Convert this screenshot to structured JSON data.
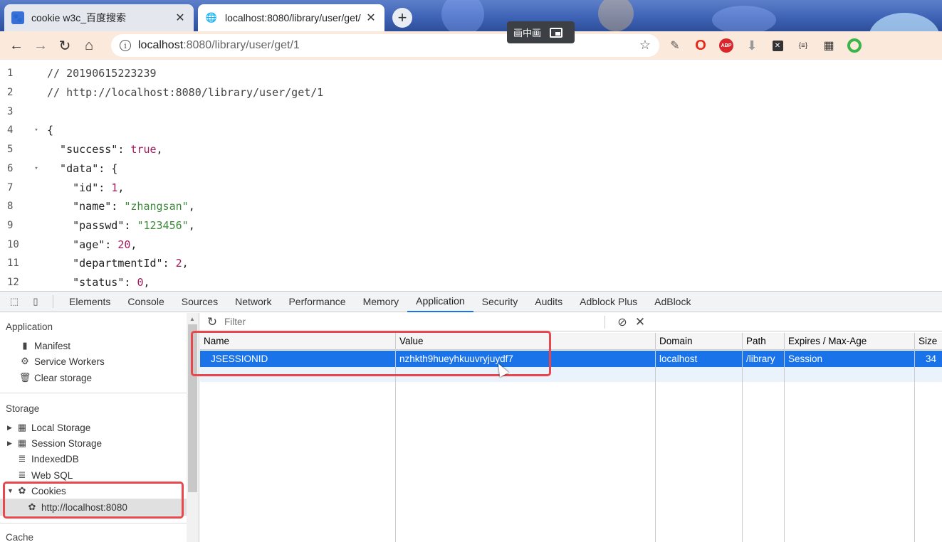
{
  "browser": {
    "tabs": [
      {
        "title": "cookie w3c_百度搜索",
        "close": "✕",
        "favicon": "baidu-icon",
        "active": false
      },
      {
        "title": "localhost:8080/library/user/get/",
        "close": "✕",
        "favicon": "globe-icon",
        "active": true
      }
    ],
    "new_tab": "+",
    "pip_label": "画中画",
    "url_host": "localhost",
    "url_path": ":8080/library/user/get/1"
  },
  "code": {
    "lines": [
      {
        "n": "1",
        "fold": "",
        "parts": [
          [
            "c-comment",
            "// 20190615223239"
          ]
        ]
      },
      {
        "n": "2",
        "fold": "",
        "parts": [
          [
            "c-comment",
            "// http://localhost:8080/library/user/get/1"
          ]
        ]
      },
      {
        "n": "3",
        "fold": "",
        "parts": []
      },
      {
        "n": "4",
        "fold": "▾",
        "parts": [
          [
            "c-key",
            "{"
          ]
        ]
      },
      {
        "n": "5",
        "fold": "",
        "parts": [
          [
            "c-key",
            "  \"success\": "
          ],
          [
            "c-bool",
            "true"
          ],
          [
            "c-key",
            ","
          ]
        ]
      },
      {
        "n": "6",
        "fold": "▾",
        "parts": [
          [
            "c-key",
            "  \"data\": {"
          ]
        ]
      },
      {
        "n": "7",
        "fold": "",
        "parts": [
          [
            "c-key",
            "    \"id\": "
          ],
          [
            "c-num",
            "1"
          ],
          [
            "c-key",
            ","
          ]
        ]
      },
      {
        "n": "8",
        "fold": "",
        "parts": [
          [
            "c-key",
            "    \"name\": "
          ],
          [
            "c-str",
            "\"zhangsan\""
          ],
          [
            "c-key",
            ","
          ]
        ]
      },
      {
        "n": "9",
        "fold": "",
        "parts": [
          [
            "c-key",
            "    \"passwd\": "
          ],
          [
            "c-str",
            "\"123456\""
          ],
          [
            "c-key",
            ","
          ]
        ]
      },
      {
        "n": "10",
        "fold": "",
        "parts": [
          [
            "c-key",
            "    \"age\": "
          ],
          [
            "c-num",
            "20"
          ],
          [
            "c-key",
            ","
          ]
        ]
      },
      {
        "n": "11",
        "fold": "",
        "parts": [
          [
            "c-key",
            "    \"departmentId\": "
          ],
          [
            "c-num",
            "2"
          ],
          [
            "c-key",
            ","
          ]
        ]
      },
      {
        "n": "12",
        "fold": "",
        "parts": [
          [
            "c-key",
            "    \"status\": "
          ],
          [
            "c-num",
            "0"
          ],
          [
            "c-key",
            ","
          ]
        ]
      }
    ]
  },
  "devtools": {
    "tabs": [
      "Elements",
      "Console",
      "Sources",
      "Network",
      "Performance",
      "Memory",
      "Application",
      "Security",
      "Audits",
      "Adblock Plus",
      "AdBlock"
    ],
    "active_tab": "Application",
    "sidebar": {
      "application_header": "Application",
      "application_items": [
        {
          "label": "Manifest",
          "icon": "document-icon"
        },
        {
          "label": "Service Workers",
          "icon": "gear-icon"
        },
        {
          "label": "Clear storage",
          "icon": "trash-icon"
        }
      ],
      "storage_header": "Storage",
      "storage_items": [
        {
          "label": "Local Storage",
          "icon": "grid-icon",
          "expandable": true
        },
        {
          "label": "Session Storage",
          "icon": "grid-icon",
          "expandable": true
        },
        {
          "label": "IndexedDB",
          "icon": "database-icon",
          "expandable": false
        },
        {
          "label": "Web SQL",
          "icon": "database-icon",
          "expandable": false
        },
        {
          "label": "Cookies",
          "icon": "cookie-icon",
          "expandable": true,
          "expanded": true
        }
      ],
      "cookie_origin": "http://localhost:8080",
      "cache_header": "Cache"
    },
    "cookies": {
      "filter_placeholder": "Filter",
      "columns": [
        "Name",
        "Value",
        "Domain",
        "Path",
        "Expires / Max-Age",
        "Size"
      ],
      "rows": [
        {
          "name": "JSESSIONID",
          "value": "nzhkth9hueyhkuuvryjuydf7",
          "domain": "localhost",
          "path": "/library",
          "expires": "Session",
          "size": "34"
        }
      ]
    }
  },
  "colors": {
    "selection": "#1a73e8",
    "highlight_box": "#e8474d",
    "toolbar": "#fbe9dc"
  }
}
